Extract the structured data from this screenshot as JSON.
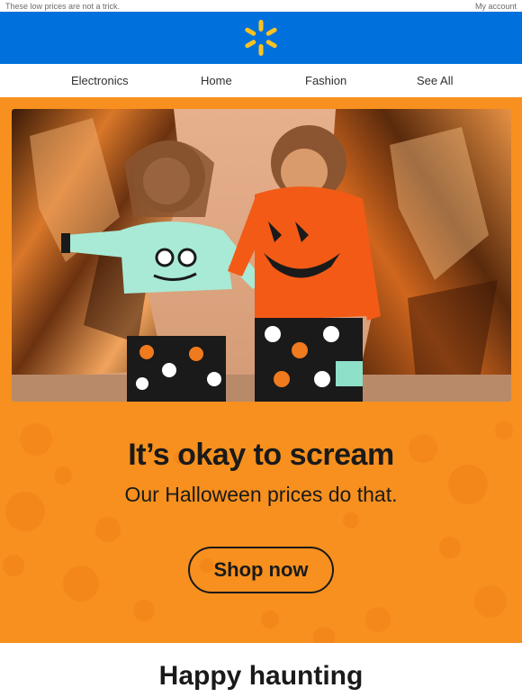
{
  "preheader": {
    "text": "These low prices are not a trick.",
    "account_link": "My account"
  },
  "brand": {
    "logo_icon": "spark-icon",
    "logo_color": "#ffc220",
    "bar_color": "#0071dc"
  },
  "nav": {
    "items": [
      {
        "label": "Electronics"
      },
      {
        "label": "Home"
      },
      {
        "label": "Fashion"
      },
      {
        "label": "See All"
      }
    ]
  },
  "hero": {
    "background_color": "#f7901e",
    "image_icon": "halloween-kids-photo",
    "headline": "It’s okay to scream",
    "subline": "Our Halloween prices do that.",
    "cta_label": "Shop now"
  },
  "next_section": {
    "title": "Happy haunting"
  }
}
